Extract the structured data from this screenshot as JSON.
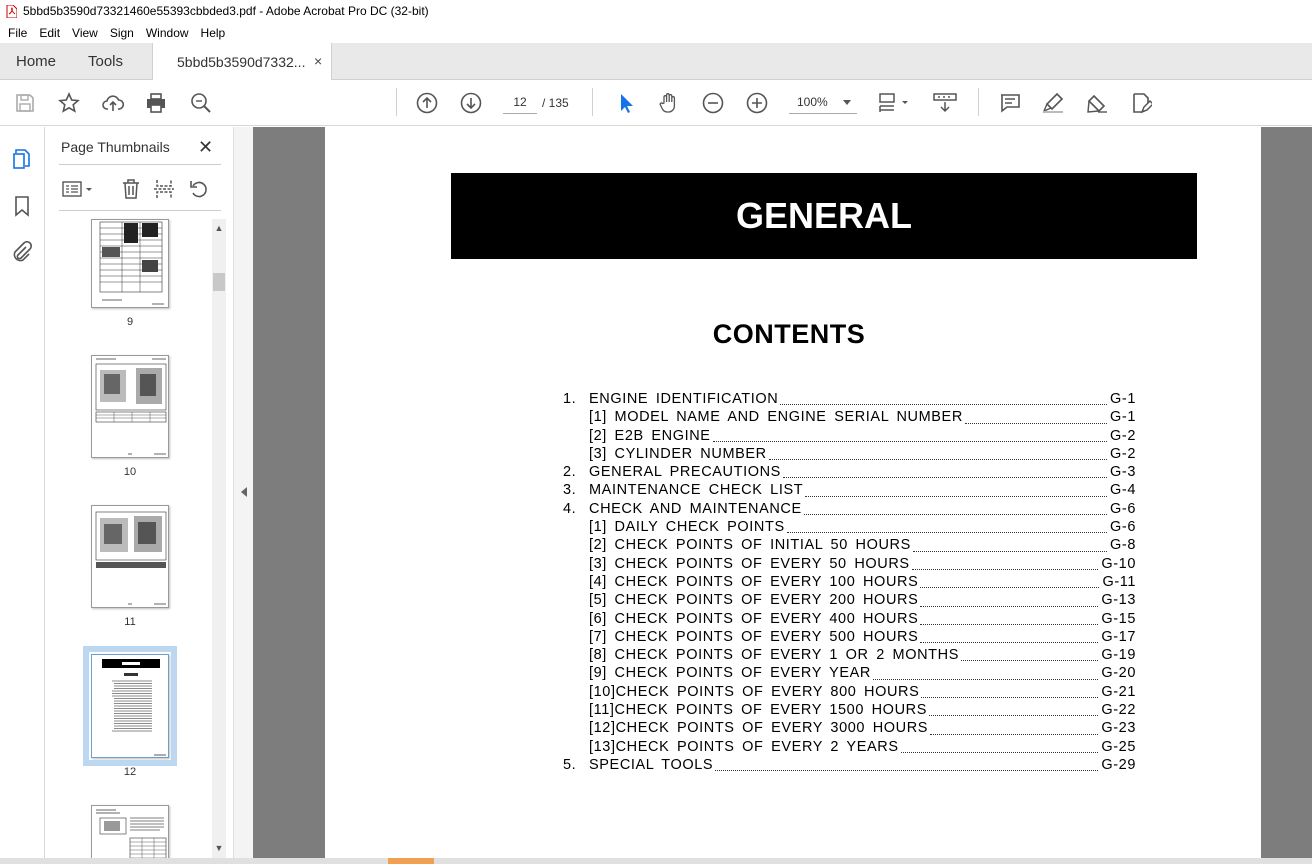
{
  "window": {
    "title": "5bbd5b3590d73321460e55393cbbded3.pdf - Adobe Acrobat Pro DC (32-bit)"
  },
  "menu": [
    "File",
    "Edit",
    "View",
    "Sign",
    "Window",
    "Help"
  ],
  "tabs": {
    "home": "Home",
    "tools": "Tools",
    "doc": "5bbd5b3590d7332...",
    "close": "×"
  },
  "nav": {
    "current_page": "12",
    "total": "/   135",
    "zoom": "100%"
  },
  "panel": {
    "title": "Page Thumbnails",
    "close": "✕"
  },
  "thumbnails": [
    {
      "label": "9"
    },
    {
      "label": "10"
    },
    {
      "label": "11"
    },
    {
      "label": "12",
      "selected": true
    },
    {
      "label": ""
    }
  ],
  "document": {
    "banner": "GENERAL",
    "contents_title": "CONTENTS",
    "toc": [
      {
        "num": "1.",
        "label": "ENGINE IDENTIFICATION",
        "page": "G-1",
        "sub": false
      },
      {
        "num": "",
        "label": "[1] MODEL NAME AND ENGINE SERIAL NUMBER",
        "page": "G-1",
        "sub": true
      },
      {
        "num": "",
        "label": "[2] E2B ENGINE",
        "page": "G-2",
        "sub": true
      },
      {
        "num": "",
        "label": "[3] CYLINDER NUMBER",
        "page": "G-2",
        "sub": true
      },
      {
        "num": "2.",
        "label": "GENERAL PRECAUTIONS",
        "page": "G-3",
        "sub": false
      },
      {
        "num": "3.",
        "label": "MAINTENANCE CHECK LIST",
        "page": "G-4",
        "sub": false
      },
      {
        "num": "4.",
        "label": "CHECK AND MAINTENANCE",
        "page": "G-6",
        "sub": false
      },
      {
        "num": "",
        "label": "[1] DAILY CHECK POINTS",
        "page": "G-6",
        "sub": true
      },
      {
        "num": "",
        "label": "[2] CHECK POINTS OF INITIAL 50 HOURS",
        "page": "G-8",
        "sub": true
      },
      {
        "num": "",
        "label": "[3] CHECK POINTS OF EVERY 50 HOURS",
        "page": "G-10",
        "sub": true
      },
      {
        "num": "",
        "label": "[4] CHECK POINTS OF EVERY 100 HOURS",
        "page": "G-11",
        "sub": true
      },
      {
        "num": "",
        "label": "[5] CHECK POINTS OF EVERY 200 HOURS",
        "page": "G-13",
        "sub": true
      },
      {
        "num": "",
        "label": "[6] CHECK POINTS OF EVERY 400 HOURS",
        "page": "G-15",
        "sub": true
      },
      {
        "num": "",
        "label": "[7] CHECK POINTS OF EVERY 500 HOURS",
        "page": "G-17",
        "sub": true
      },
      {
        "num": "",
        "label": "[8] CHECK POINTS OF EVERY 1 OR 2 MONTHS",
        "page": "G-19",
        "sub": true
      },
      {
        "num": "",
        "label": "[9] CHECK POINTS OF EVERY YEAR",
        "page": "G-20",
        "sub": true
      },
      {
        "num": "",
        "label": "[10]CHECK POINTS OF EVERY 800 HOURS",
        "page": "G-21",
        "sub": true
      },
      {
        "num": "",
        "label": "[11]CHECK POINTS OF EVERY 1500 HOURS",
        "page": "G-22",
        "sub": true
      },
      {
        "num": "",
        "label": "[12]CHECK POINTS OF EVERY 3000 HOURS",
        "page": "G-23",
        "sub": true
      },
      {
        "num": "",
        "label": "[13]CHECK POINTS OF EVERY 2 YEARS",
        "page": "G-25",
        "sub": true
      },
      {
        "num": "5.",
        "label": "SPECIAL TOOLS",
        "page": "G-29",
        "sub": false
      }
    ]
  },
  "colors": {
    "accent": "#1473e6",
    "canvas": "#7d7d7d",
    "selection": "#bcd7ef"
  }
}
